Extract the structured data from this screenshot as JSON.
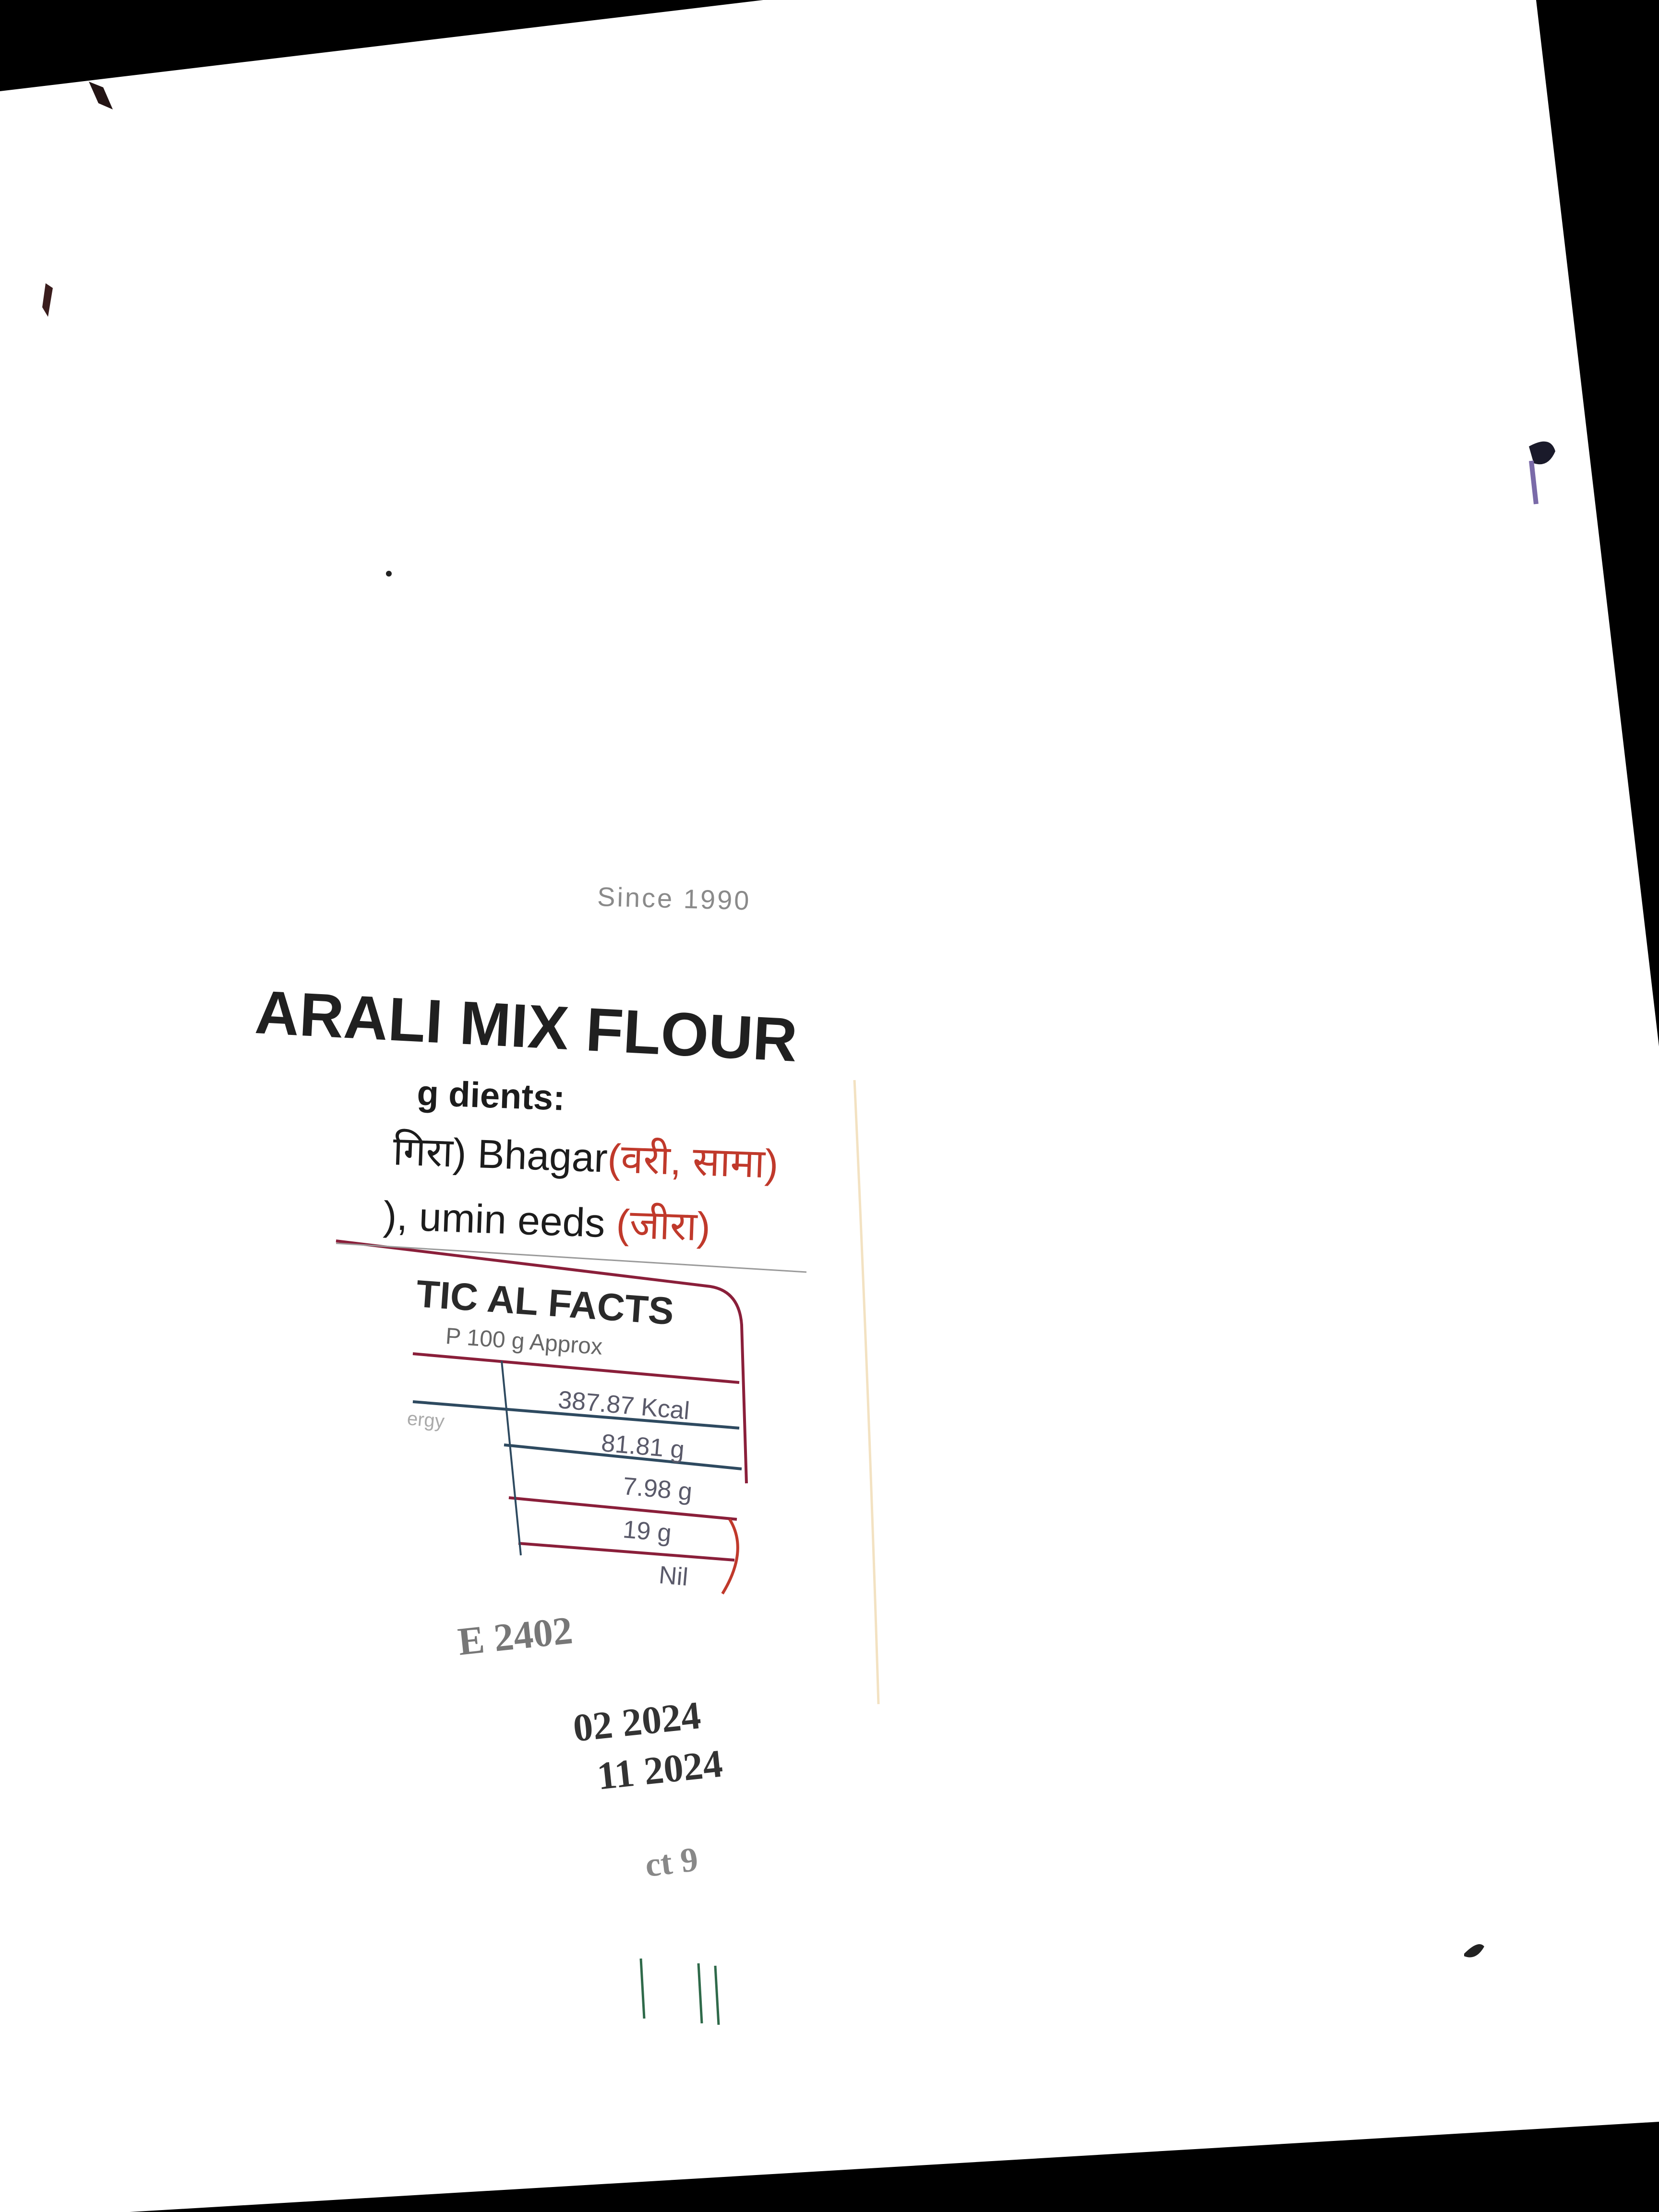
{
  "image": {
    "background": "#000000",
    "paper_color": "#ffffff",
    "accent_red": "#c0392b",
    "table_line_color": "#8a1f3a",
    "description_free": true
  },
  "label": {
    "since": "Since 1990",
    "title": "ARALI MIX FLOUR",
    "ingredients_heading": "g dients:",
    "ingredient_line1_a": "गिरा)  Bhagar",
    "ingredient_line1_b": "(वरी, सामा)",
    "ingredient_line2_a": "), umin eeds ",
    "ingredient_line2_b": "(जीरा)",
    "nutrition_heading": "TIC AL FACTS",
    "nutrition_subheading": "P 100 g Approx",
    "row_label_0": "ergy",
    "row_values": [
      "387.87 Kcal",
      "81.81 g",
      "7.98 g",
      "19 g",
      "Nil"
    ],
    "batch_lines": [
      "E 2402",
      "02 2024",
      "11 2024",
      "ct 9"
    ]
  }
}
